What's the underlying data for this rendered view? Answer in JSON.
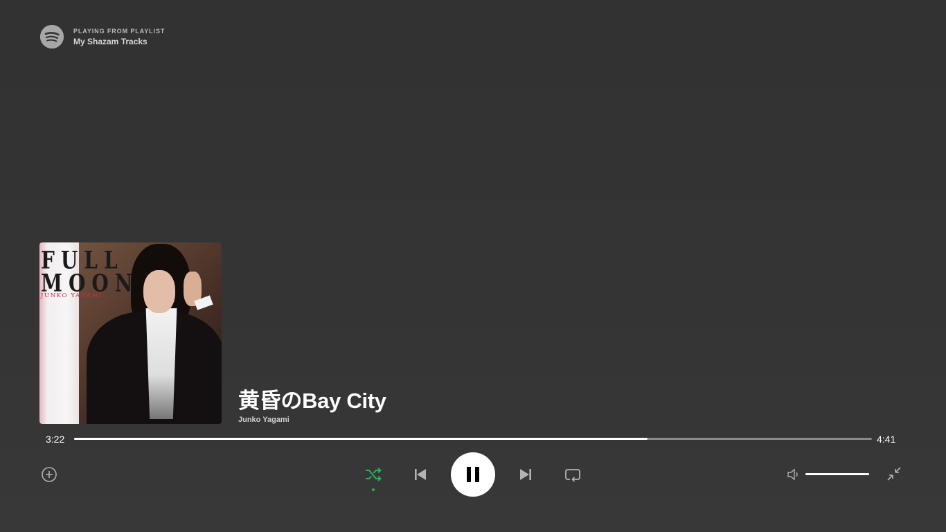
{
  "context": {
    "label": "PLAYING FROM PLAYLIST",
    "playlist_name": "My Shazam Tracks",
    "logo_icon": "spotify-logo-icon"
  },
  "album_art": {
    "cover_title_line1": "FULL",
    "cover_title_line2": "MOON",
    "cover_artist": "JUNKO YAGAMI"
  },
  "track": {
    "title": "黄昏のBay City",
    "artist": "Junko Yagami"
  },
  "playback": {
    "current_time": "3:22",
    "total_time": "4:41",
    "progress_fraction": 0.719,
    "shuffle_active": true,
    "is_playing": true,
    "volume_fraction": 1.0
  },
  "icons": {
    "add": "add-circle-icon",
    "shuffle": "shuffle-icon",
    "previous": "skip-previous-icon",
    "play_pause": "pause-icon",
    "next": "skip-next-icon",
    "repeat": "repeat-icon",
    "volume": "volume-icon",
    "exit_fullscreen": "exit-fullscreen-icon"
  },
  "colors": {
    "background": "#333333",
    "accent_green": "#1db954",
    "progress_fill": "#ffffff",
    "progress_track": "#8a8a8a"
  }
}
